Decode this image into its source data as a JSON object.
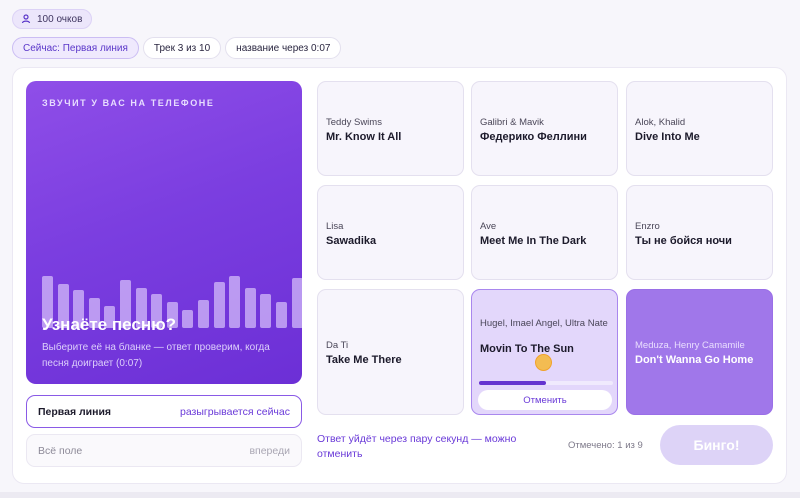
{
  "points": {
    "label": "100 очков",
    "icon": "users-icon"
  },
  "chips": [
    "Сейчас: Первая линия",
    "Трек 3 из 10",
    "название через 0:07"
  ],
  "now_playing": {
    "label": "ЗВУЧИТ У ВАС НА ТЕЛЕФОНЕ",
    "title": "Узнаёте песню?",
    "hint": "Выберите её на бланке — ответ проверим, когда песня доиграет (0:07)"
  },
  "lines": [
    {
      "label": "Первая линия",
      "status": "разыгрывается сейчас"
    },
    {
      "label": "Всё поле",
      "status": "впереди"
    }
  ],
  "card": [
    {
      "artist": "Teddy Swims",
      "title": "Mr. Know It All"
    },
    {
      "artist": "Galibri & Mavik",
      "title": "Федерико Феллини"
    },
    {
      "artist": "Alok, Khalid",
      "title": "Dive Into Me"
    },
    {
      "artist": "Lisa",
      "title": "Sawadika"
    },
    {
      "artist": "Ave",
      "title": "Meet Me In The Dark"
    },
    {
      "artist": "Enzro",
      "title": "Ты не бойся ночи"
    },
    {
      "artist": "Da Ti",
      "title": "Take Me There"
    },
    {
      "artist": "Hugel, Imael Angel, Ultra Nate",
      "title": "Movin To The Sun",
      "state": "pending",
      "progress": 0.5,
      "cancel_label": "Отменить"
    },
    {
      "artist": "Meduza, Henry Camamile",
      "title": "Don't Wanna Go Home",
      "state": "marked"
    }
  ],
  "footer": {
    "notice": "Ответ уйдёт через пару секунд — можно отменить",
    "marked_count": "Отмечено: 1 из 9",
    "bingo_label": "Бинго!"
  },
  "colors": {
    "accent": "#6a3ad8",
    "player_bg": "#7b3ee0",
    "marked_cell": "#a077ea",
    "bingo_disabled": "#ddd3f7"
  }
}
